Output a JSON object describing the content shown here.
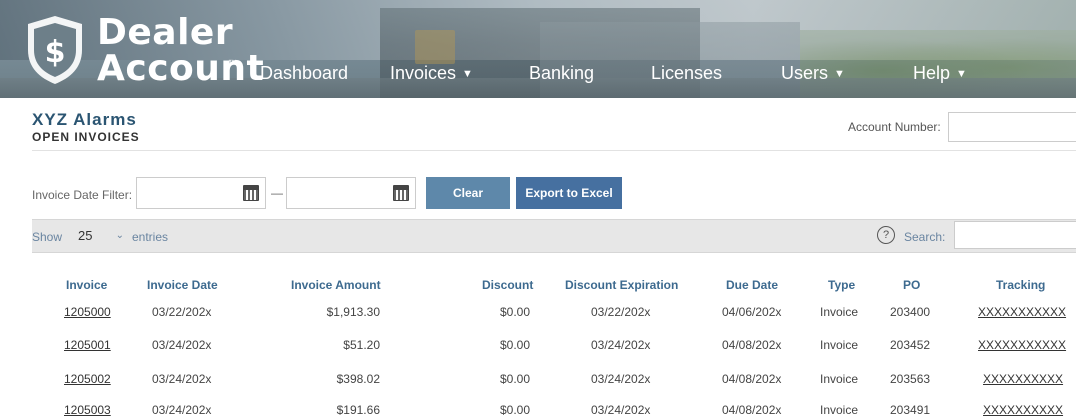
{
  "brand": {
    "line1": "Dealer",
    "line2": "Account",
    "tm": "™"
  },
  "nav": [
    {
      "label": "Dashboard",
      "caret": ""
    },
    {
      "label": "Invoices",
      "caret": "▼"
    },
    {
      "label": "Banking",
      "caret": ""
    },
    {
      "label": "Licenses",
      "caret": ""
    },
    {
      "label": "Users",
      "caret": "▼"
    },
    {
      "label": "Help",
      "caret": "▼"
    }
  ],
  "page": {
    "company": "XYZ Alarms",
    "subtitle": "OPEN INVOICES",
    "account_label": "Account Number:",
    "account_value": ""
  },
  "filter": {
    "label": "Invoice Date Filter:",
    "from": "",
    "to": "",
    "dash": "—",
    "clear_label": "Clear",
    "export_label": "Export to Excel"
  },
  "table_controls": {
    "show": "Show",
    "entries_value": "25",
    "entries": "entries",
    "search_label": "Search:",
    "search_value": "",
    "help": "?"
  },
  "columns": [
    "Invoice",
    "Invoice Date",
    "Invoice Amount",
    "Discount",
    "Discount Expiration",
    "Due Date",
    "Type",
    "PO",
    "Tracking"
  ],
  "rows": [
    {
      "invoice": "1205000",
      "date": "03/22/202x",
      "amount": "$1,913.30",
      "discount": "$0.00",
      "expiration": "03/22/202x",
      "due": "04/06/202x",
      "type": "Invoice",
      "po": "203400",
      "tracking": "XXXXXXXXXXX"
    },
    {
      "invoice": "1205001",
      "date": "03/24/202x",
      "amount": "$51.20",
      "discount": "$0.00",
      "expiration": "03/24/202x",
      "due": "04/08/202x",
      "type": "Invoice",
      "po": "203452",
      "tracking": "XXXXXXXXXXX"
    },
    {
      "invoice": "1205002",
      "date": "03/24/202x",
      "amount": "$398.02",
      "discount": "$0.00",
      "expiration": "03/24/202x",
      "due": "04/08/202x",
      "type": "Invoice",
      "po": "203563",
      "tracking": "XXXXXXXXXX"
    },
    {
      "invoice": "1205003",
      "date": "03/24/202x",
      "amount": "$191.66",
      "discount": "$0.00",
      "expiration": "03/24/202x",
      "due": "04/08/202x",
      "type": "Invoice",
      "po": "203491",
      "tracking": "XXXXXXXXXX"
    }
  ]
}
